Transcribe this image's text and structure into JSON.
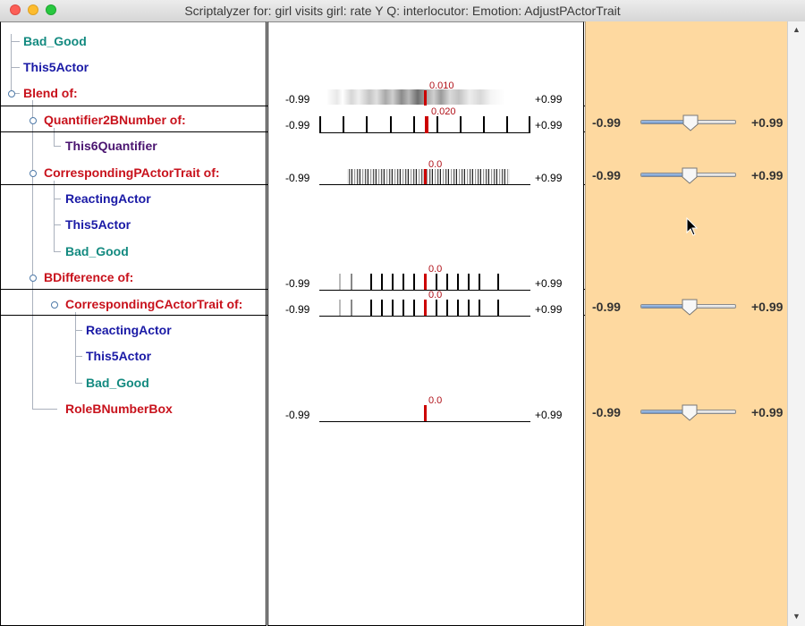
{
  "window": {
    "title": "Scriptalyzer for: girl visits girl: rate Y Q: interlocutor: Emotion: AdjustPActorTrait"
  },
  "tree": {
    "nodes": [
      {
        "label": "Bad_Good",
        "color": "#138a80"
      },
      {
        "label": "This5Actor",
        "color": "#1a1aa6"
      },
      {
        "label": "Blend of:",
        "color": "#c8121c"
      },
      {
        "label": "Quantifier2BNumber of:",
        "color": "#c8121c"
      },
      {
        "label": "This6Quantifier",
        "color": "#4a1470"
      },
      {
        "label": "CorrespondingPActorTrait of:",
        "color": "#c8121c"
      },
      {
        "label": "ReactingActor",
        "color": "#1a1aa6"
      },
      {
        "label": "This5Actor",
        "color": "#1a1aa6"
      },
      {
        "label": "Bad_Good",
        "color": "#138a80"
      },
      {
        "label": "BDifference of:",
        "color": "#c8121c"
      },
      {
        "label": "CorrespondingCActorTrait of:",
        "color": "#c8121c"
      },
      {
        "label": "ReactingActor",
        "color": "#1a1aa6"
      },
      {
        "label": "This5Actor",
        "color": "#1a1aa6"
      },
      {
        "label": "Bad_Good",
        "color": "#138a80"
      },
      {
        "label": "RoleBNumberBox",
        "color": "#c8121c"
      }
    ]
  },
  "scales": {
    "min_label": "-0.99",
    "max_label": "+0.99",
    "rows": [
      {
        "value_label": "0.010",
        "value": 0.01,
        "kind": "density"
      },
      {
        "value_label": "0.020",
        "value": 0.02,
        "kind": "ticks"
      },
      {
        "value_label": "0.0",
        "value": 0.0,
        "kind": "density2"
      },
      {
        "value_label": "0.0",
        "value": 0.0,
        "kind": "ticks2"
      },
      {
        "value_label": "0.0",
        "value": 0.0,
        "kind": "ticks2"
      },
      {
        "value_label": "0.0",
        "value": 0.0,
        "kind": "single"
      }
    ]
  },
  "sliders": {
    "min_label": "-0.99",
    "max_label": "+0.99",
    "items": [
      {
        "name": "quantifier2bnumber-slider",
        "value": 0.0
      },
      {
        "name": "correspondingpactortrait-slider",
        "value": 0.0
      },
      {
        "name": "correspondingcactortrait-slider",
        "value": 0.0
      },
      {
        "name": "rolebnumberbox-slider",
        "value": 0.0
      }
    ]
  },
  "colors": {
    "right_panel_bg": "#fed9a0",
    "value_marker": "#cc0000"
  }
}
